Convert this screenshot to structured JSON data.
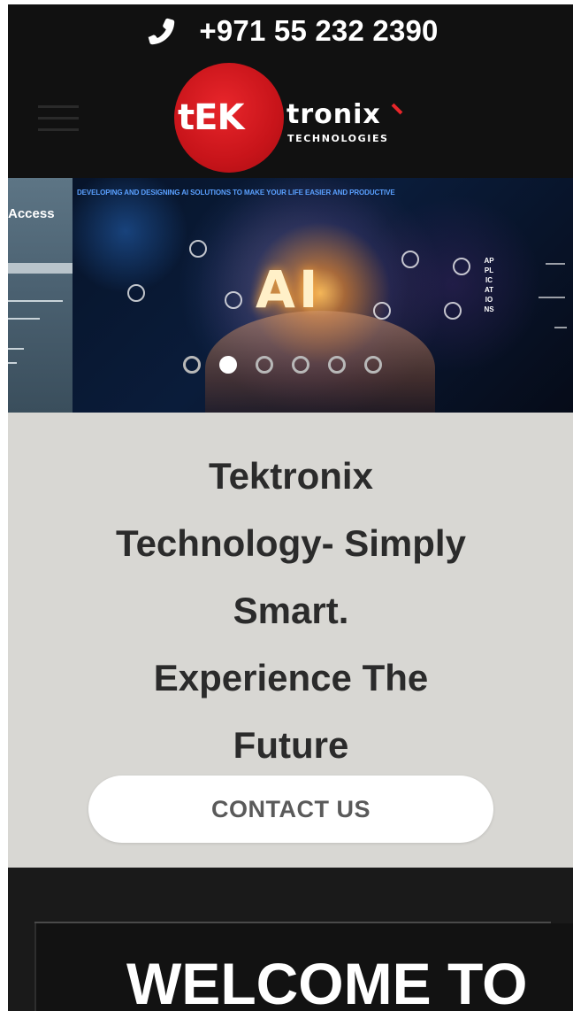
{
  "header": {
    "phone_number": "+971 55 232 2390",
    "icons": {
      "phone": "phone-icon",
      "menu": "hamburger-menu-icon"
    },
    "logo": {
      "tek": "tEK",
      "tronix": "tronix",
      "subtitle": "TECHNOLOGIES",
      "brand_color": "#d4181e"
    }
  },
  "slider": {
    "left_panel_label": "Access",
    "tagline": "DEVELOPING AND DESIGNING AI SOLUTIONS TO MAKE YOUR LIFE EASIER AND PRODUCTIVE",
    "center_text": "AI",
    "vertical_label": "APPLICATIONS",
    "slide_count": 6,
    "active_slide": 2
  },
  "hero": {
    "title_line1": "Tektronix",
    "title_line2": "Technology- Simply",
    "title_line3": "Smart.",
    "title_line4": "Experience The",
    "title_line5": "Future",
    "contact_label": "CONTACT US"
  },
  "welcome": {
    "heading": "WELCOME TO"
  },
  "colors": {
    "header_bg": "#111111",
    "hero_bg": "#d8d7d3",
    "welcome_bg": "#1a1a1a",
    "text_dark": "#2b2b2b"
  }
}
